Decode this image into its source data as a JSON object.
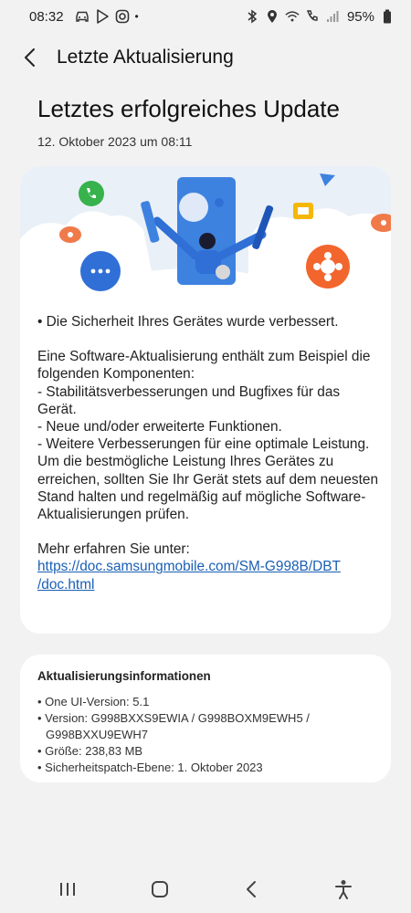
{
  "status_bar": {
    "time": "08:32",
    "battery": "95%",
    "dot": "•"
  },
  "header": {
    "title": "Letzte Aktualisierung"
  },
  "page": {
    "title": "Letztes erfolgreiches Update",
    "date": "12. Oktober 2023 um 08:11"
  },
  "content": {
    "security_line": "• Die Sicherheit Ihres Gerätes wurde verbessert.",
    "intro": "Eine Software-Aktualisierung enthält zum Beispiel die folgenden Komponenten:",
    "item1": " - Stabilitätsverbesserungen und Bugfixes für das Gerät.",
    "item2": " - Neue und/oder erweiterte Funktionen.",
    "item3": " - Weitere Verbesserungen für eine optimale Leistung.",
    "advice": "Um die bestmögliche Leistung Ihres Gerätes zu erreichen, sollten Sie Ihr Gerät stets auf dem neuesten Stand halten und regelmäßig auf mögliche Software-Aktualisierungen prüfen.",
    "more_label": "Mehr erfahren Sie unter:",
    "link_line1": "https://doc.samsungmobile.com/SM-G998B/DBT",
    "link_line2": "/doc.html"
  },
  "info": {
    "title": "Aktualisierungsinformationen",
    "ui_version": "• One UI-Version: 5.1",
    "version_line1": "• Version: G998BXXS9EWIA / G998BOXM9EWH5 /",
    "version_line2": "G998BXXU9EWH7",
    "size": "• Größe: 238,83 MB",
    "patch": "• Sicherheitspatch-Ebene: 1. Oktober 2023"
  },
  "icons": {
    "back": "chevron-left-icon",
    "recents": "recents-icon",
    "home": "home-icon",
    "nav_back": "nav-back-icon",
    "accessibility": "accessibility-icon"
  },
  "colors": {
    "background": "#f2f2f2",
    "card": "#ffffff",
    "link": "#1a5fb4",
    "illustration_blue": "#2f6fd6",
    "illustration_orange": "#f2662d"
  }
}
